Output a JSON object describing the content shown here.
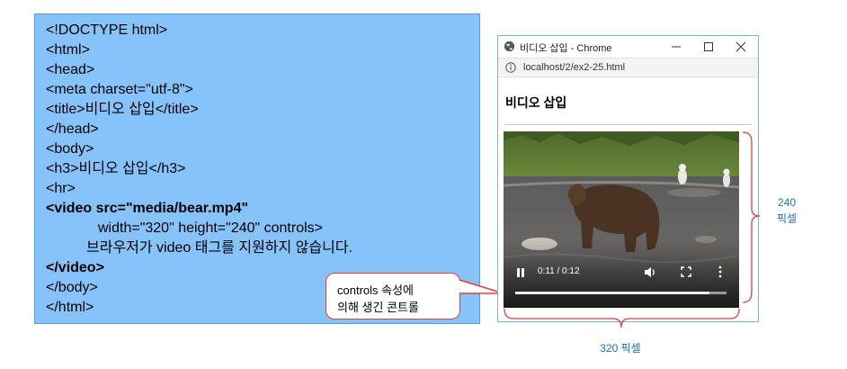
{
  "code": {
    "lines": [
      "<!DOCTYPE html>",
      "<html>",
      "<head>",
      "<meta charset=\"utf-8\">",
      "<title>비디오 삽입</title>",
      "</head>",
      "<body>",
      "<h3>비디오 삽입</h3>",
      "<hr>",
      "<video src=\"media/bear.mp4\"",
      "width=\"320\" height=\"240\" controls>",
      "브라우저가 video 태그를 지원하지 않습니다.",
      "</video>",
      "</body>",
      "</html>"
    ]
  },
  "callout": {
    "line1": "controls 속성에",
    "line2": "의해 생긴 콘트롤"
  },
  "browser": {
    "window_title": "비디오 삽입 - Chrome",
    "url": "localhost/2/ex2-25.html",
    "page_heading": "비디오 삽입"
  },
  "video": {
    "time_display": "0:11 / 0:12",
    "progress": 0.92
  },
  "annotations": {
    "height_value": "240",
    "height_unit": "픽셀",
    "width_label": "320 픽셀"
  },
  "colors": {
    "code_panel_bg": "#87c3fb",
    "callout_border": "#e0403a",
    "annotation": "#1f6fb2"
  }
}
